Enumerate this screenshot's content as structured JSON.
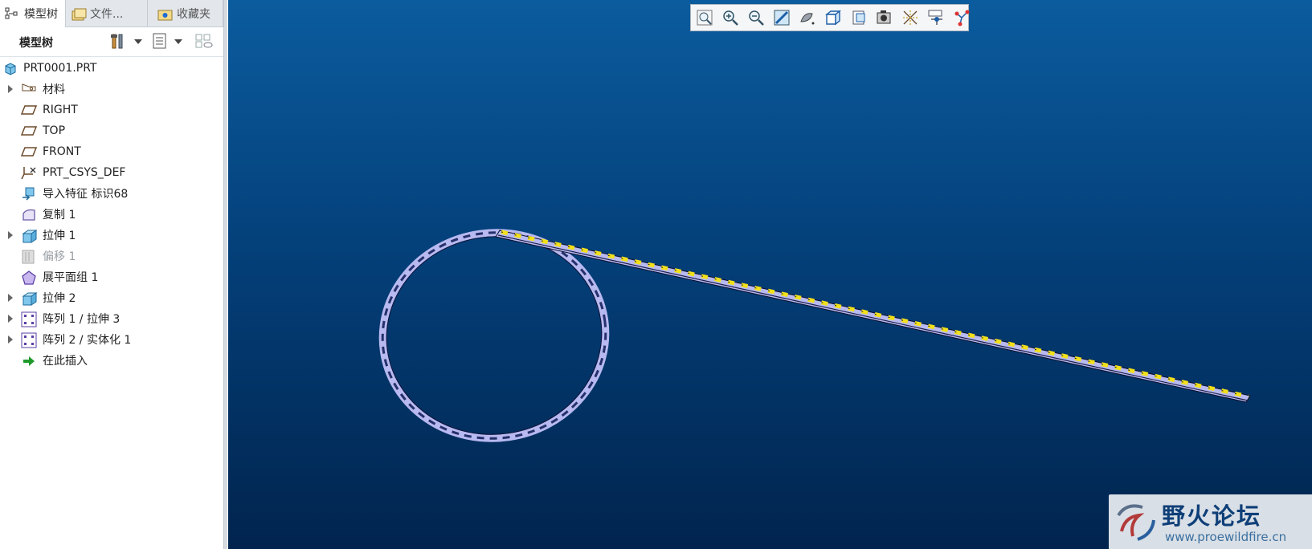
{
  "tabs": [
    {
      "label": "模型树",
      "icon": "model-tree-icon"
    },
    {
      "label": "文件...",
      "icon": "folder-browser-icon"
    },
    {
      "label": "收藏夹",
      "icon": "favorites-icon"
    }
  ],
  "tree_panel": {
    "title": "模型树",
    "toolbar_icons": [
      "settings-tools-icon",
      "show-options-icon",
      "filter-icon"
    ]
  },
  "tree": {
    "root": "PRT0001.PRT",
    "items": [
      {
        "label": "材料",
        "icon": "material-icon",
        "expandable": true
      },
      {
        "label": "RIGHT",
        "icon": "datum-plane-icon",
        "expandable": false
      },
      {
        "label": "TOP",
        "icon": "datum-plane-icon",
        "expandable": false
      },
      {
        "label": "FRONT",
        "icon": "datum-plane-icon",
        "expandable": false
      },
      {
        "label": "PRT_CSYS_DEF",
        "icon": "coordinate-system-icon",
        "expandable": false
      },
      {
        "label": "导入特征 标识68",
        "icon": "import-feature-icon",
        "expandable": false
      },
      {
        "label": "复制 1",
        "icon": "copy-surface-icon",
        "expandable": false
      },
      {
        "label": "拉伸 1",
        "icon": "extrude-icon",
        "expandable": true
      },
      {
        "label": "偏移 1",
        "icon": "offset-icon",
        "expandable": false,
        "suppressed": true
      },
      {
        "label": "展平面组 1",
        "icon": "flatten-quilt-icon",
        "expandable": false
      },
      {
        "label": "拉伸 2",
        "icon": "extrude-icon",
        "expandable": true
      },
      {
        "label": "阵列 1 / 拉伸 3",
        "icon": "pattern-icon",
        "expandable": true
      },
      {
        "label": "阵列 2 / 实体化 1",
        "icon": "pattern-icon",
        "expandable": true
      },
      {
        "label": "在此插入",
        "icon": "insert-here-arrow-icon",
        "expandable": false
      }
    ]
  },
  "view_toolbar": [
    "refit-icon",
    "zoom-in-icon",
    "zoom-out-icon",
    "repaint-icon",
    "display-style-icon",
    "saved-orientations-icon",
    "view-manager-icon",
    "perspective-icon",
    "datum-display-icon",
    "spin-center-icon",
    "annotation-display-icon"
  ],
  "watermark": {
    "title": "野火论坛",
    "url": "www.proewildfire.cn"
  },
  "colors": {
    "viewport_top": "#0b5c9e",
    "viewport_bottom": "#01244e",
    "part_fill": "#b7b9f0",
    "led_yellow": "#f2e01a"
  }
}
